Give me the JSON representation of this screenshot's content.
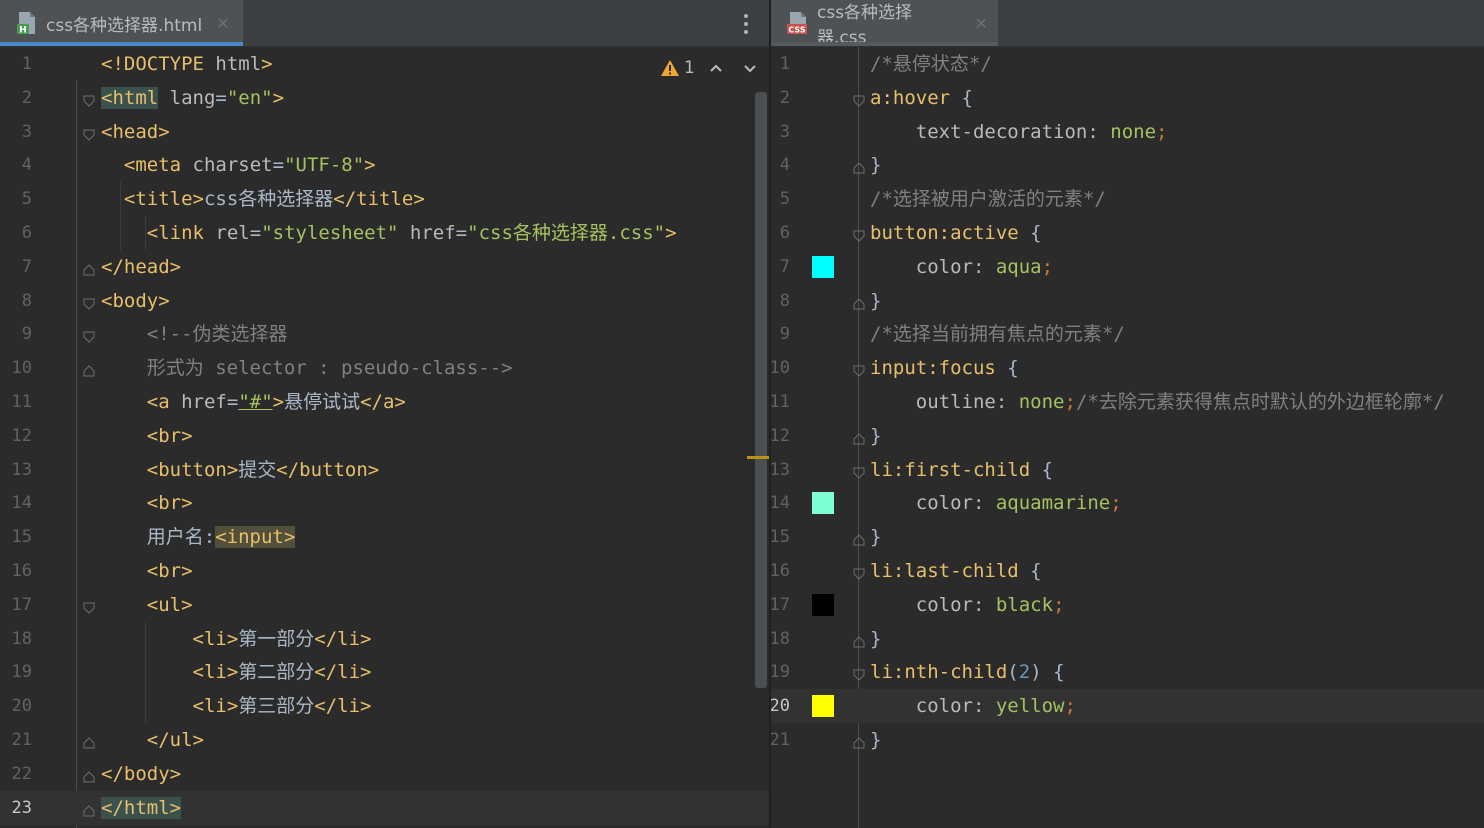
{
  "left_editor": {
    "tab": {
      "filename": "css各种选择器.html",
      "icon": "html-file-icon",
      "close": "✕"
    },
    "warning": {
      "icon": "warning-icon",
      "count": "1"
    },
    "current_line": 23,
    "line_numbers": [
      "1",
      "2",
      "3",
      "4",
      "5",
      "6",
      "7",
      "8",
      "9",
      "10",
      "11",
      "12",
      "13",
      "14",
      "15",
      "16",
      "17",
      "18",
      "19",
      "20",
      "21",
      "22",
      "23"
    ],
    "lines": [
      [
        [
          "tag",
          "<!DOCTYPE "
        ],
        [
          "attr",
          "html"
        ],
        [
          "tag",
          ">"
        ]
      ],
      [
        [
          "tag",
          "<html"
        ],
        [
          "attr",
          " lang"
        ],
        [
          "txt",
          "="
        ],
        [
          "str",
          "\"en\""
        ],
        [
          "tag",
          ">"
        ]
      ],
      [
        [
          "tag",
          "<head>"
        ]
      ],
      [
        [
          "txt",
          "  "
        ],
        [
          "tag",
          "<meta"
        ],
        [
          "attr",
          " charset"
        ],
        [
          "txt",
          "="
        ],
        [
          "str",
          "\"UTF-8\""
        ],
        [
          "tag",
          ">"
        ]
      ],
      [
        [
          "txt",
          "  "
        ],
        [
          "tag",
          "<title>"
        ],
        [
          "txt",
          "css各种选择器"
        ],
        [
          "tag",
          "</title>"
        ]
      ],
      [
        [
          "txt",
          "    "
        ],
        [
          "tag",
          "<link"
        ],
        [
          "attr",
          " rel"
        ],
        [
          "txt",
          "="
        ],
        [
          "str",
          "\"stylesheet\""
        ],
        [
          "attr",
          " href"
        ],
        [
          "txt",
          "="
        ],
        [
          "str",
          "\"css各种选择器.css\""
        ],
        [
          "tag",
          ">"
        ]
      ],
      [
        [
          "tag",
          "</head>"
        ]
      ],
      [
        [
          "tag",
          "<body>"
        ]
      ],
      [
        [
          "txt",
          "    "
        ],
        [
          "cmt",
          "<!--伪类选择器"
        ]
      ],
      [
        [
          "txt",
          "    "
        ],
        [
          "cmt",
          "形式为 selector : pseudo-class-->"
        ]
      ],
      [
        [
          "txt",
          "    "
        ],
        [
          "tag",
          "<a"
        ],
        [
          "attr",
          " href"
        ],
        [
          "txt",
          "="
        ],
        [
          "str",
          "\"#\""
        ],
        [
          "tag",
          ">"
        ],
        [
          "txt",
          "悬停试试"
        ],
        [
          "tag",
          "</a>"
        ]
      ],
      [
        [
          "txt",
          "    "
        ],
        [
          "tag",
          "<br>"
        ]
      ],
      [
        [
          "txt",
          "    "
        ],
        [
          "tag",
          "<button>"
        ],
        [
          "txt",
          "提交"
        ],
        [
          "tag",
          "</button>"
        ]
      ],
      [
        [
          "txt",
          "    "
        ],
        [
          "tag",
          "<br>"
        ]
      ],
      [
        [
          "txt",
          "    用户名:"
        ],
        [
          "tag",
          "<input>"
        ]
      ],
      [
        [
          "txt",
          "    "
        ],
        [
          "tag",
          "<br>"
        ]
      ],
      [
        [
          "txt",
          "    "
        ],
        [
          "tag",
          "<ul>"
        ]
      ],
      [
        [
          "txt",
          "        "
        ],
        [
          "tag",
          "<li>"
        ],
        [
          "txt",
          "第一部分"
        ],
        [
          "tag",
          "</li>"
        ]
      ],
      [
        [
          "txt",
          "        "
        ],
        [
          "tag",
          "<li>"
        ],
        [
          "txt",
          "第二部分"
        ],
        [
          "tag",
          "</li>"
        ]
      ],
      [
        [
          "txt",
          "        "
        ],
        [
          "tag",
          "<li>"
        ],
        [
          "txt",
          "第三部分"
        ],
        [
          "tag",
          "</li>"
        ]
      ],
      [
        [
          "txt",
          "    "
        ],
        [
          "tag",
          "</ul>"
        ]
      ],
      [
        [
          "tag",
          "</body>"
        ]
      ],
      [
        [
          "tag",
          "</html>"
        ]
      ]
    ]
  },
  "right_editor": {
    "tab": {
      "filename": "css各种选择器.css",
      "icon": "css-file-icon",
      "close": "✕"
    },
    "current_line": 20,
    "line_numbers": [
      "1",
      "2",
      "3",
      "4",
      "5",
      "6",
      "7",
      "8",
      "9",
      "10",
      "11",
      "12",
      "13",
      "14",
      "15",
      "16",
      "17",
      "18",
      "19",
      "20",
      "21"
    ],
    "lines": [
      [
        [
          "cmt",
          "/*悬停状态*/"
        ]
      ],
      [
        [
          "sel",
          "a"
        ],
        [
          "pcls",
          ":hover"
        ],
        [
          "brace",
          " {"
        ]
      ],
      [
        [
          "txt",
          "    "
        ],
        [
          "prop",
          "text-decoration"
        ],
        [
          "txt",
          ": "
        ],
        [
          "val",
          "none"
        ],
        [
          "punct",
          ";"
        ]
      ],
      [
        [
          "brace",
          "}"
        ]
      ],
      [
        [
          "cmt",
          "/*选择被用户激活的元素*/"
        ]
      ],
      [
        [
          "sel",
          "button"
        ],
        [
          "pcls",
          ":active"
        ],
        [
          "brace",
          " {"
        ]
      ],
      [
        [
          "txt",
          "    "
        ],
        [
          "prop",
          "color"
        ],
        [
          "txt",
          ": "
        ],
        [
          "val",
          "aqua"
        ],
        [
          "punct",
          ";"
        ]
      ],
      [
        [
          "brace",
          "}"
        ]
      ],
      [
        [
          "cmt",
          "/*选择当前拥有焦点的元素*/"
        ]
      ],
      [
        [
          "sel",
          "input"
        ],
        [
          "pcls",
          ":focus"
        ],
        [
          "brace",
          " {"
        ]
      ],
      [
        [
          "txt",
          "    "
        ],
        [
          "prop",
          "outline"
        ],
        [
          "txt",
          ": "
        ],
        [
          "val",
          "none"
        ],
        [
          "punct",
          ";"
        ],
        [
          "cmt",
          "/*去除元素获得焦点时默认的外边框轮廓*/"
        ]
      ],
      [
        [
          "brace",
          "}"
        ]
      ],
      [
        [
          "sel",
          "li"
        ],
        [
          "pcls",
          ":first-child"
        ],
        [
          "brace",
          " {"
        ]
      ],
      [
        [
          "txt",
          "    "
        ],
        [
          "prop",
          "color"
        ],
        [
          "txt",
          ": "
        ],
        [
          "val",
          "aquamarine"
        ],
        [
          "punct",
          ";"
        ]
      ],
      [
        [
          "brace",
          "}"
        ]
      ],
      [
        [
          "sel",
          "li"
        ],
        [
          "pcls",
          ":last-child"
        ],
        [
          "brace",
          " {"
        ]
      ],
      [
        [
          "txt",
          "    "
        ],
        [
          "prop",
          "color"
        ],
        [
          "txt",
          ": "
        ],
        [
          "val",
          "black"
        ],
        [
          "punct",
          ";"
        ]
      ],
      [
        [
          "brace",
          "}"
        ]
      ],
      [
        [
          "sel",
          "li"
        ],
        [
          "pcls",
          ":nth-child"
        ],
        [
          "txt",
          "("
        ],
        [
          "num",
          "2"
        ],
        [
          "txt",
          ")"
        ],
        [
          "brace",
          " {"
        ]
      ],
      [
        [
          "txt",
          "    "
        ],
        [
          "prop",
          "color"
        ],
        [
          "txt",
          ": "
        ],
        [
          "val",
          "yellow"
        ],
        [
          "punct",
          ";"
        ]
      ],
      [
        [
          "brace",
          "}"
        ]
      ]
    ],
    "color_swatches": [
      {
        "line": 7,
        "color": "#00ffff"
      },
      {
        "line": 14,
        "color": "#7fffd4"
      },
      {
        "line": 17,
        "color": "#000000"
      },
      {
        "line": 20,
        "color": "#ffff00"
      }
    ]
  }
}
